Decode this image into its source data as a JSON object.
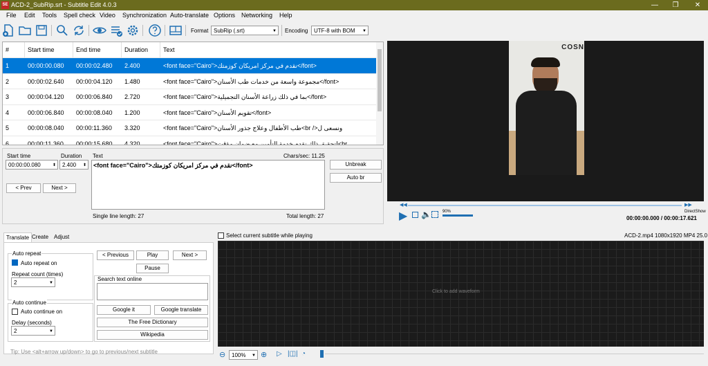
{
  "titlebar": {
    "title": "ACD-2_SubRip.srt - Subtitle Edit 4.0.3",
    "logo": "SE",
    "min": "—",
    "max": "❐",
    "close": "✕"
  },
  "menu": [
    "File",
    "Edit",
    "Tools",
    "Spell check",
    "Video",
    "Synchronization",
    "Auto-translate",
    "Options",
    "Networking",
    "Help"
  ],
  "toolbar": {
    "format_label": "Format",
    "format_value": "SubRip (.srt)",
    "encoding_label": "Encoding",
    "encoding_value": "UTF-8 with BOM"
  },
  "grid": {
    "headers": [
      "#",
      "Start time",
      "End time",
      "Duration",
      "Text"
    ],
    "rows": [
      {
        "n": "1",
        "start": "00:00:00.080",
        "end": "00:00:02.480",
        "dur": "2.400",
        "text": "<font face=\"Cairo\">نقدم في مركز امريكان كوزمتك</font>"
      },
      {
        "n": "2",
        "start": "00:00:02.640",
        "end": "00:00:04.120",
        "dur": "1.480",
        "text": "<font face=\"Cairo\">مجموعة واسعة من خدمات طب الأسنان</font>"
      },
      {
        "n": "3",
        "start": "00:00:04.120",
        "end": "00:00:06.840",
        "dur": "2.720",
        "text": "<font face=\"Cairo\">بما في ذلك زراعة الأسنان التجميلية</font>"
      },
      {
        "n": "4",
        "start": "00:00:06.840",
        "end": "00:00:08.040",
        "dur": "1.200",
        "text": "<font face=\"Cairo\">تقويم الأسنان</font>"
      },
      {
        "n": "5",
        "start": "00:00:08.040",
        "end": "00:00:11.360",
        "dur": "3.320",
        "text": "<font face=\"Cairo\">طب الأطفال وعلاج جذور الأسنان<br />ونسعى ل"
      },
      {
        "n": "6",
        "start": "00:00:11.360",
        "end": "00:00:15.680",
        "dur": "4.320",
        "text": "<font face=\"Cairo\">لتحقيق ذلك نقدم خدمة التأمين مع ضمان مؤقت<br"
      }
    ]
  },
  "edit": {
    "start_label": "Start time",
    "start_value": "00:00:00.080",
    "dur_label": "Duration",
    "dur_value": "2.400",
    "text_label": "Text",
    "chars_sec": "Chars/sec: 11.25",
    "text_value": "<font face=\"Cairo\">نقدم في مركز امريكان كوزمتك</font>",
    "prev": "< Prev",
    "next": "Next >",
    "unbreak": "Unbreak",
    "autobr": "Auto br",
    "single_len": "Single line length: 27",
    "total_len": "Total length: 27"
  },
  "video": {
    "brand": "COSN",
    "time": "00:00:00.000 / 00:00:17.621",
    "vol": "90%",
    "directshow": "DirectShow"
  },
  "waveform": {
    "select_label": "Select current subtitle while playing",
    "file_info": "ACD-2.mp4 1080x1920 MP4 25.0",
    "hint": "Click to add waveform",
    "zoom": "100%"
  },
  "tabs": {
    "items": [
      "Translate",
      "Create",
      "Adjust"
    ],
    "auto_repeat": "Auto repeat",
    "auto_repeat_on": "Auto repeat on",
    "repeat_count": "Repeat count (times)",
    "repeat_value": "2",
    "auto_continue": "Auto continue",
    "auto_continue_on": "Auto continue on",
    "delay": "Delay (seconds)",
    "delay_value": "2",
    "previous": "< Previous",
    "play": "Play",
    "next": "Next >",
    "pause": "Pause",
    "search_online": "Search text online",
    "google_it": "Google it",
    "google_translate": "Google translate",
    "free_dict": "The Free Dictionary",
    "wikipedia": "Wikipedia"
  },
  "tip": "Tip: Use <alt+arrow up/down> to go to previous/next subtitle"
}
